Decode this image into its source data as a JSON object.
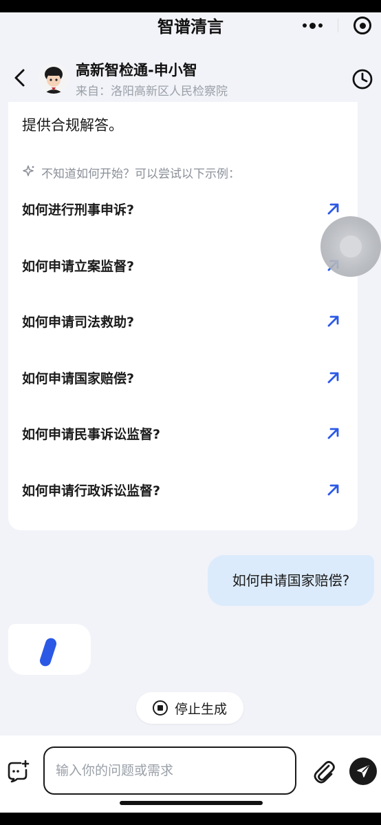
{
  "app": {
    "title": "智谱清言"
  },
  "header": {
    "agent_name": "高新智检通-申小智",
    "source": "来自：洛阳高新区人民检察院"
  },
  "conversation": {
    "intro_text": "提供合规解答。",
    "hint": "不知道如何开始？可以尝试以下示例：",
    "examples": [
      {
        "label": "如何进行刑事申诉?"
      },
      {
        "label": "如何申请立案监督?"
      },
      {
        "label": "如何申请司法救助?"
      },
      {
        "label": "如何申请国家赔偿?"
      },
      {
        "label": "如何申请民事诉讼监督?"
      },
      {
        "label": "如何申请行政诉讼监督?"
      }
    ],
    "user_message": "如何申请国家赔偿?"
  },
  "controls": {
    "stop_label": "停止生成",
    "input_placeholder": "输入你的问题或需求",
    "input_value": ""
  },
  "colors": {
    "accent": "#2b59e6",
    "user_bubble": "#dcebfb",
    "background": "#f2f3f8"
  },
  "icons": [
    "back-icon",
    "more-dots-icon",
    "target-icon",
    "history-clock-icon",
    "sparkle-icon",
    "arrow-up-right-icon",
    "stop-icon",
    "add-media-icon",
    "paperclip-icon",
    "send-icon"
  ]
}
